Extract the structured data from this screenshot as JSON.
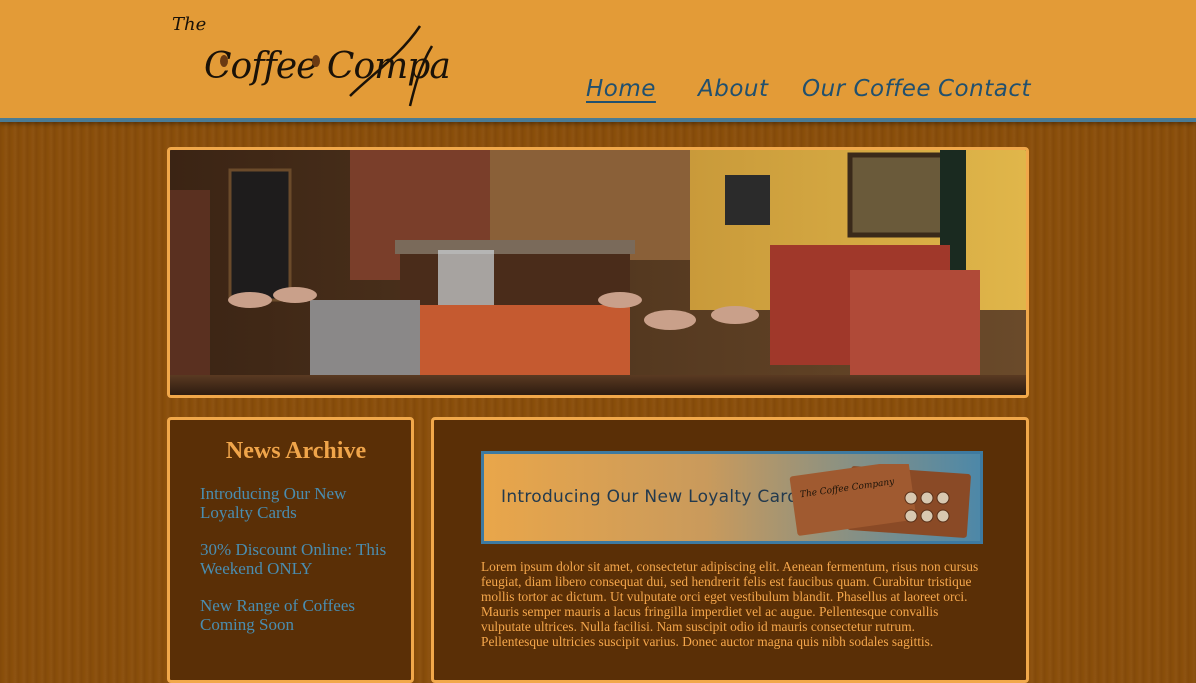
{
  "logo": {
    "text_the": "The",
    "text_main": "Coffee Company"
  },
  "nav": {
    "items": [
      {
        "label": "Home",
        "active": true
      },
      {
        "label": "About",
        "active": false
      },
      {
        "label": "Our Coffee",
        "active": false
      },
      {
        "label": "Contact",
        "active": false
      }
    ]
  },
  "hero": {
    "description": "cafe interior photo"
  },
  "news": {
    "title": "News Archive",
    "items": [
      "Introducing Our New Loyalty Cards",
      "30% Discount Online: This Weekend ONLY",
      "New Range of Coffees Coming Soon"
    ]
  },
  "main": {
    "banner_text": "Introducing Our New Loyalty Cards",
    "card_logo_text": "The Coffee Company",
    "body": "Lorem ipsum dolor sit amet, consectetur adipiscing elit. Aenean fermentum, risus non cursus feugiat, diam libero consequat dui, sed hendrerit felis est faucibus quam. Curabitur tristique mollis tortor ac dictum. Ut vulputate orci eget vestibulum blandit. Phasellus at laoreet orci. Mauris semper mauris a lacus fringilla imperdiet vel ac augue. Pellentesque convallis vulputate ultrices. Nulla facilisi. Nam suscipit odio id mauris consectetur rutrum. Pellentesque ultricies suscipit varius. Donec auctor magna quis nibh sodales sagittis."
  },
  "colors": {
    "header_bg": "#e39b37",
    "header_border": "#4a7b95",
    "page_bg": "#8a4e0a",
    "panel_bg": "#5a2f06",
    "panel_border": "#f1a84a",
    "nav_text": "#21506e",
    "news_link": "#4a8db0",
    "body_text": "#f5a74c"
  }
}
